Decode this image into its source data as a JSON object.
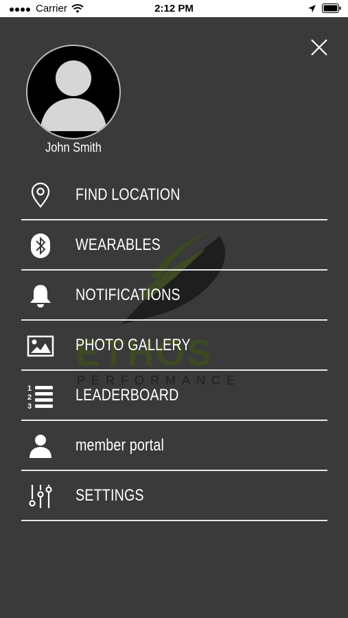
{
  "status_bar": {
    "carrier": "Carrier",
    "time": "2:12 PM"
  },
  "profile": {
    "name": "John Smith"
  },
  "watermark": {
    "brand": "ETHOS",
    "tagline": "PERFORMANCE"
  },
  "menu": {
    "items": [
      {
        "label": "FIND LOCATION",
        "icon": "location-pin-icon"
      },
      {
        "label": "WEARABLES",
        "icon": "bluetooth-icon"
      },
      {
        "label": "NOTIFICATIONS",
        "icon": "bell-icon"
      },
      {
        "label": "PHOTO GALLERY",
        "icon": "image-icon"
      },
      {
        "label": "LEADERBOARD",
        "icon": "numbered-list-icon"
      },
      {
        "label": "member portal",
        "icon": "person-icon"
      },
      {
        "label": "SETTINGS",
        "icon": "sliders-icon"
      }
    ]
  },
  "colors": {
    "background": "#3a3a3a",
    "divider": "#e9e9e9",
    "text": "#ffffff"
  }
}
